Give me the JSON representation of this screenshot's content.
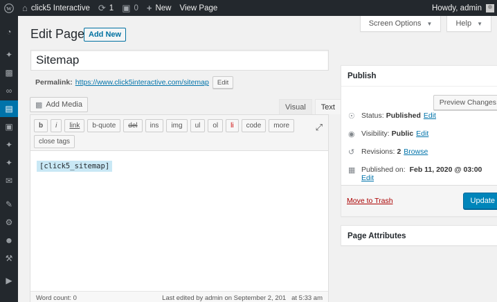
{
  "adminbar": {
    "site_name": "click5 Interactive",
    "updates_count": "1",
    "comments_count": "0",
    "new_label": "New",
    "view_page": "View Page",
    "howdy": "Howdy, admin"
  },
  "screen_meta": {
    "screen_options": "Screen Options",
    "help": "Help"
  },
  "page": {
    "title": "Edit Page",
    "add_new": "Add New"
  },
  "post": {
    "title": "Sitemap",
    "permalink_label": "Permalink:",
    "permalink_url": "https://www.click5interactive.com/sitemap",
    "permalink_edit": "Edit"
  },
  "editor": {
    "add_media": "Add Media",
    "tab_visual": "Visual",
    "tab_text": "Text",
    "quicktags": [
      "b",
      "i",
      "link",
      "b-quote",
      "del",
      "ins",
      "img",
      "ul",
      "ol",
      "li",
      "code",
      "more"
    ],
    "close_tags": "close tags",
    "content": "[click5_sitemap]",
    "word_count": "Word count: 0",
    "last_edited": "Last edited by admin on September 2, 201   at 5:33 am"
  },
  "publish": {
    "title": "Publish",
    "preview_changes": "Preview Changes",
    "status_label": "Status:",
    "status_value": "Published",
    "visibility_label": "Visibility:",
    "visibility_value": "Public",
    "revisions_label": "Revisions:",
    "revisions_value": "2",
    "browse": "Browse",
    "published_label": "Published on:",
    "published_value": "Feb 11, 2020 @ 03:00",
    "edit": "Edit",
    "move_to_trash": "Move to Trash",
    "update": "Update"
  },
  "attributes": {
    "title": "Page Attributes"
  },
  "colors": {
    "accent": "#0073aa",
    "button_primary": "#0085ba",
    "trash": "#a00000",
    "admin_dark": "#23282d"
  }
}
